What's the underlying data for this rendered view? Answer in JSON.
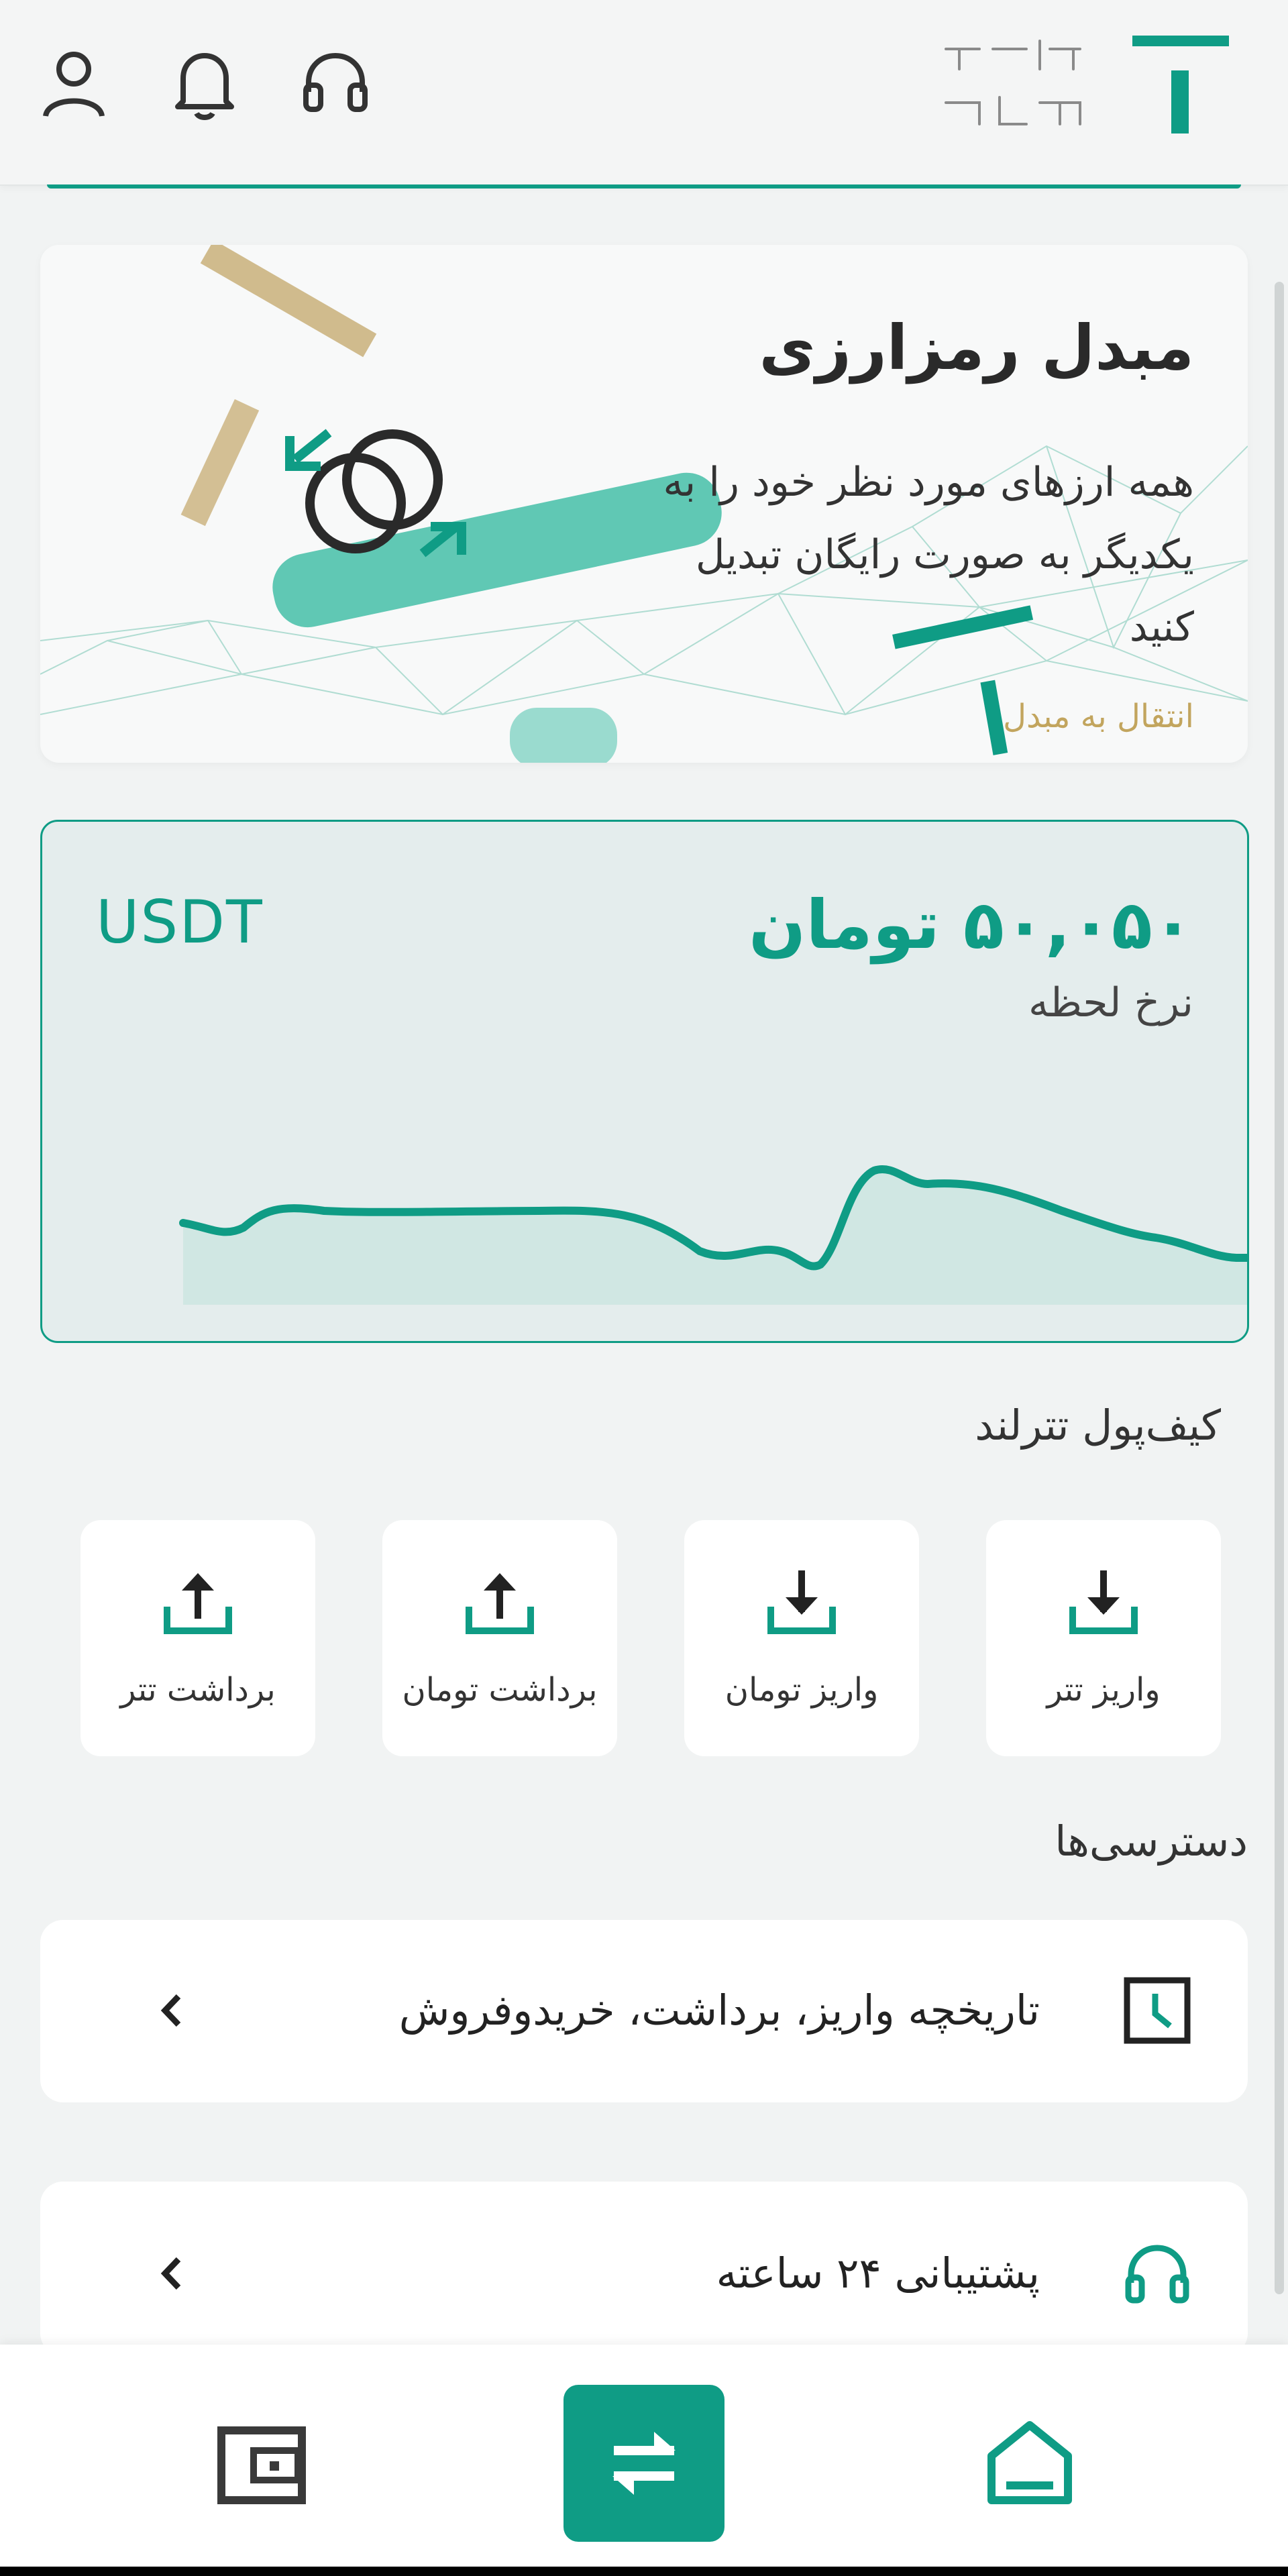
{
  "colors": {
    "accent": "#0f9c85",
    "gold": "#c2a55e",
    "background": "#f1f3f3"
  },
  "header": {
    "logo_line1": "تتر",
    "logo_line2": "لند",
    "icons": [
      "profile-icon",
      "bell-icon",
      "headset-icon"
    ]
  },
  "converter": {
    "title": "مبدل رمزارزی",
    "description": "همه ارزهای مورد نظر خود را به یکدیگر به صورت رایگان تبدیل کنید",
    "link": "انتقال به مبدل"
  },
  "rate": {
    "value": "۵۰,۰۵۰ تومان",
    "label": "نرخ لحظه",
    "currency": "USDT"
  },
  "wallet": {
    "title": "کیف‌پول تترلند",
    "actions": [
      {
        "label": "واریز تتر",
        "icon": "deposit-icon"
      },
      {
        "label": "واریز تومان",
        "icon": "deposit-icon"
      },
      {
        "label": "برداشت تومان",
        "icon": "withdraw-icon"
      },
      {
        "label": "برداشت تتر",
        "icon": "withdraw-icon"
      }
    ]
  },
  "access": {
    "title": "دسترسی‌ها",
    "items": [
      {
        "label": "تاریخچه واریز، برداشت، خریدوفروش",
        "icon": "clock-icon"
      },
      {
        "label": "پشتیبانی ۲۴ ساعته",
        "icon": "headset-icon"
      }
    ]
  },
  "bottom_nav": [
    "home-icon",
    "exchange-icon",
    "wallet-icon"
  ]
}
